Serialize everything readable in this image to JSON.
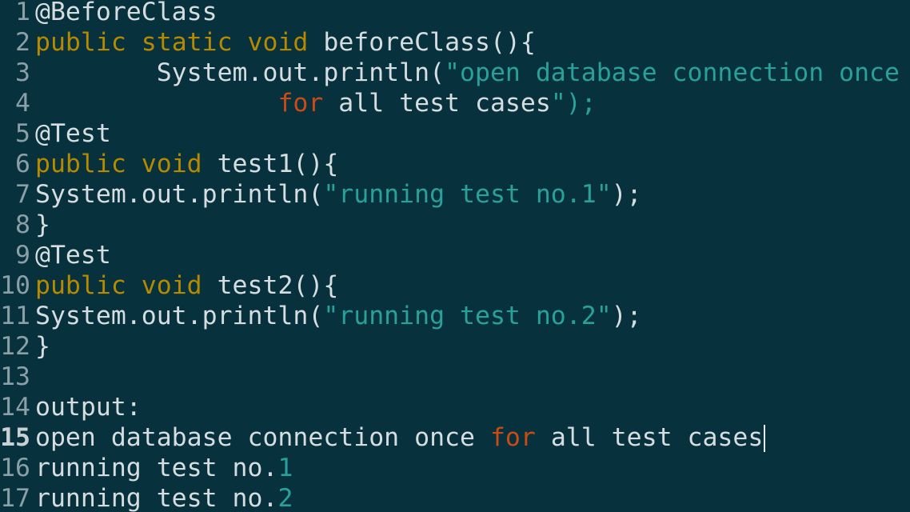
{
  "editor": {
    "current_line": 15,
    "lines": [
      {
        "num": "1",
        "tokens": [
          {
            "t": "@BeforeClass",
            "c": "plain"
          }
        ]
      },
      {
        "num": "2",
        "tokens": [
          {
            "t": "public",
            "c": "kw"
          },
          {
            "t": " ",
            "c": "plain"
          },
          {
            "t": "static",
            "c": "kw"
          },
          {
            "t": " ",
            "c": "plain"
          },
          {
            "t": "void",
            "c": "kw"
          },
          {
            "t": " beforeClass(){",
            "c": "plain"
          }
        ]
      },
      {
        "num": "3",
        "tokens": [
          {
            "t": "        System.out.println(",
            "c": "plain"
          },
          {
            "t": "\"open database connection once",
            "c": "str"
          }
        ]
      },
      {
        "num": "4",
        "tokens": [
          {
            "t": "                ",
            "c": "plain"
          },
          {
            "t": "for",
            "c": "kw2"
          },
          {
            "t": " all test cases",
            "c": "plain"
          },
          {
            "t": "\");",
            "c": "str"
          }
        ]
      },
      {
        "num": "5",
        "tokens": [
          {
            "t": "@Test",
            "c": "plain"
          }
        ]
      },
      {
        "num": "6",
        "tokens": [
          {
            "t": "public",
            "c": "kw"
          },
          {
            "t": " ",
            "c": "plain"
          },
          {
            "t": "void",
            "c": "kw"
          },
          {
            "t": " test1(){",
            "c": "plain"
          }
        ]
      },
      {
        "num": "7",
        "tokens": [
          {
            "t": "System.out.println(",
            "c": "plain"
          },
          {
            "t": "\"running test no.1\"",
            "c": "str"
          },
          {
            "t": ");",
            "c": "plain"
          }
        ]
      },
      {
        "num": "8",
        "tokens": [
          {
            "t": "}",
            "c": "plain"
          }
        ]
      },
      {
        "num": "9",
        "tokens": [
          {
            "t": "@Test",
            "c": "plain"
          }
        ]
      },
      {
        "num": "10",
        "tokens": [
          {
            "t": "public",
            "c": "kw"
          },
          {
            "t": " ",
            "c": "plain"
          },
          {
            "t": "void",
            "c": "kw"
          },
          {
            "t": " test2(){",
            "c": "plain"
          }
        ]
      },
      {
        "num": "11",
        "tokens": [
          {
            "t": "System.out.println(",
            "c": "plain"
          },
          {
            "t": "\"running test no.2\"",
            "c": "str"
          },
          {
            "t": ");",
            "c": "plain"
          }
        ]
      },
      {
        "num": "12",
        "tokens": [
          {
            "t": "}",
            "c": "plain"
          }
        ]
      },
      {
        "num": "13",
        "tokens": []
      },
      {
        "num": "14",
        "tokens": [
          {
            "t": "output:",
            "c": "plain"
          }
        ]
      },
      {
        "num": "15",
        "tokens": [
          {
            "t": "open database connection once ",
            "c": "plain"
          },
          {
            "t": "for",
            "c": "kw2"
          },
          {
            "t": " all test cases",
            "c": "plain"
          }
        ]
      },
      {
        "num": "16",
        "tokens": [
          {
            "t": "running test no.",
            "c": "plain"
          },
          {
            "t": "1",
            "c": "str"
          }
        ]
      },
      {
        "num": "17",
        "tokens": [
          {
            "t": "running test no.",
            "c": "plain"
          },
          {
            "t": "2",
            "c": "str"
          }
        ]
      }
    ]
  },
  "colors": {
    "background": "#06313d",
    "keyword": "#b58900",
    "string": "#2aa198",
    "keyword_alt": "#cb4b16",
    "text": "#d6dde0",
    "gutter": "#8a9fa6"
  }
}
